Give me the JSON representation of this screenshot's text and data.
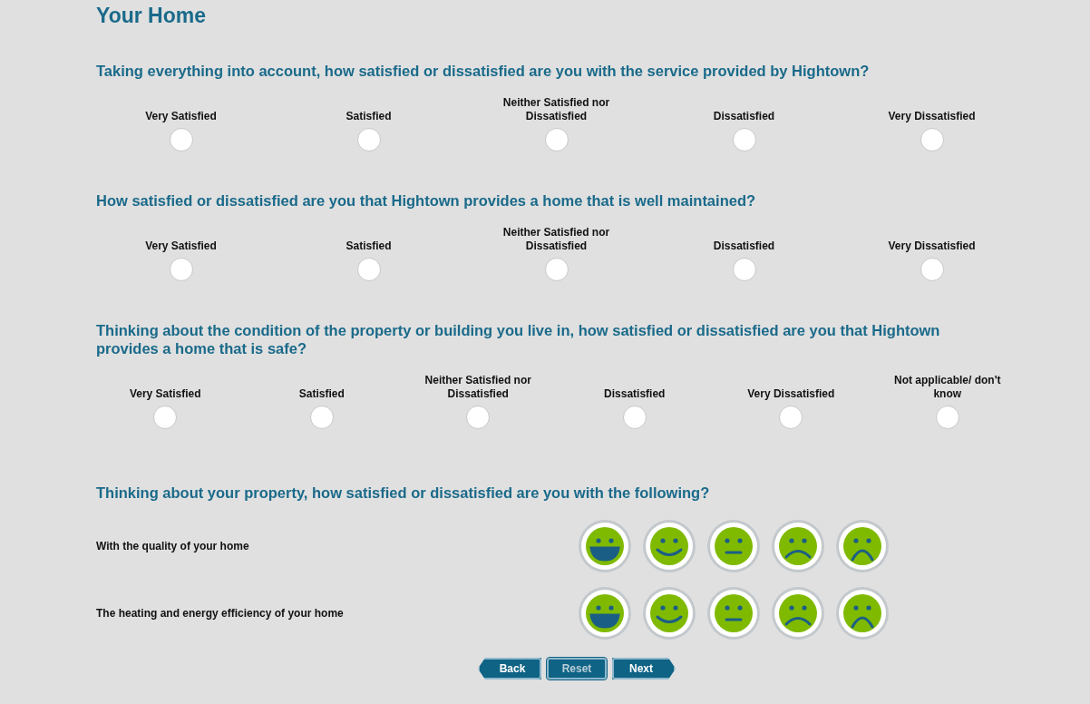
{
  "title": "Your Home",
  "questions": [
    {
      "text": "Taking everything into account, how satisfied or dissatisfied are you with the service provided by Hightown?",
      "options": [
        {
          "label": "Very Satisfied",
          "selected": false
        },
        {
          "label": "Satisfied",
          "selected": false
        },
        {
          "label": "Neither Satisfied nor Dissatisfied",
          "selected": false
        },
        {
          "label": "Dissatisfied",
          "selected": false
        },
        {
          "label": "Very Dissatisfied",
          "selected": false
        }
      ]
    },
    {
      "text": "How satisfied or dissatisfied are you that Hightown provides a home that is well maintained?",
      "options": [
        {
          "label": "Very Satisfied",
          "selected": false
        },
        {
          "label": "Satisfied",
          "selected": false
        },
        {
          "label": "Neither Satisfied nor Dissatisfied",
          "selected": false
        },
        {
          "label": "Dissatisfied",
          "selected": false
        },
        {
          "label": "Very Dissatisfied",
          "selected": false
        }
      ]
    },
    {
      "text": "Thinking about the condition of the property or building you live in, how satisfied or dissatisfied are you that Hightown provides a home that is safe?",
      "options": [
        {
          "label": "Very Satisfied",
          "selected": false
        },
        {
          "label": "Satisfied",
          "selected": false
        },
        {
          "label": "Neither Satisfied nor Dissatisfied",
          "selected": false
        },
        {
          "label": "Dissatisfied",
          "selected": false
        },
        {
          "label": "Very Dissatisfied",
          "selected": false
        },
        {
          "label": "Not applicable/ don't know",
          "selected": false
        }
      ]
    }
  ],
  "matrix": {
    "text": "Thinking about your property, how satisfied or dissatisfied are you with the following?",
    "rows": [
      {
        "label": "With the quality of your home",
        "faces": [
          {
            "kind": "grin",
            "selected": false
          },
          {
            "kind": "smile",
            "selected": false
          },
          {
            "kind": "neutral",
            "selected": false
          },
          {
            "kind": "frown",
            "selected": false
          },
          {
            "kind": "sad",
            "selected": false
          }
        ]
      },
      {
        "label": "The heating and energy efficiency of your home",
        "faces": [
          {
            "kind": "grin",
            "selected": false
          },
          {
            "kind": "smile",
            "selected": false
          },
          {
            "kind": "neutral",
            "selected": false
          },
          {
            "kind": "frown",
            "selected": false
          },
          {
            "kind": "sad",
            "selected": false
          }
        ]
      }
    ]
  },
  "buttons": [
    {
      "label": "Back",
      "kind": "back",
      "disabled": false
    },
    {
      "label": "Reset",
      "kind": "plain",
      "disabled": true
    },
    {
      "label": "Next",
      "kind": "next",
      "disabled": false
    }
  ]
}
